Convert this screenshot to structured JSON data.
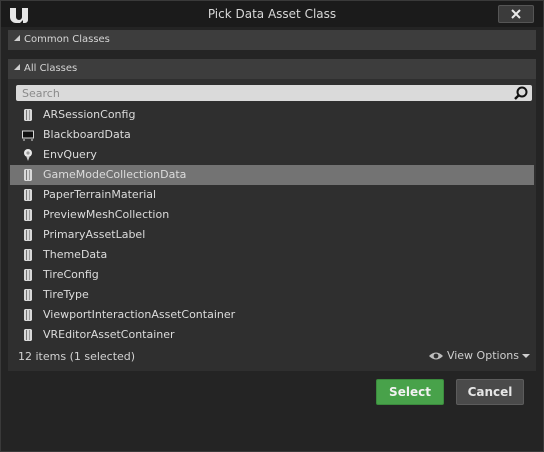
{
  "window": {
    "title": "Pick Data Asset Class",
    "close_label": "✕"
  },
  "sections": {
    "common": "Common Classes",
    "all": "All Classes"
  },
  "search": {
    "placeholder": "Search",
    "value": ""
  },
  "classes": [
    {
      "label": "ARSessionConfig",
      "icon": "data-asset-icon",
      "selected": false
    },
    {
      "label": "BlackboardData",
      "icon": "blackboard-icon",
      "selected": false
    },
    {
      "label": "EnvQuery",
      "icon": "env-query-icon",
      "selected": false
    },
    {
      "label": "GameModeCollectionData",
      "icon": "data-asset-icon",
      "selected": true
    },
    {
      "label": "PaperTerrainMaterial",
      "icon": "data-asset-icon",
      "selected": false
    },
    {
      "label": "PreviewMeshCollection",
      "icon": "data-asset-icon",
      "selected": false
    },
    {
      "label": "PrimaryAssetLabel",
      "icon": "data-asset-icon",
      "selected": false
    },
    {
      "label": "ThemeData",
      "icon": "data-asset-icon",
      "selected": false
    },
    {
      "label": "TireConfig",
      "icon": "data-asset-icon",
      "selected": false
    },
    {
      "label": "TireType",
      "icon": "data-asset-icon",
      "selected": false
    },
    {
      "label": "ViewportInteractionAssetContainer",
      "icon": "data-asset-icon",
      "selected": false
    },
    {
      "label": "VREditorAssetContainer",
      "icon": "data-asset-icon",
      "selected": false
    }
  ],
  "status": {
    "count_text": "12 items (1 selected)",
    "view_options_label": "View Options"
  },
  "buttons": {
    "select": "Select",
    "cancel": "Cancel"
  },
  "colors": {
    "select_button": "#48a24a",
    "selected_row": "#737373"
  }
}
